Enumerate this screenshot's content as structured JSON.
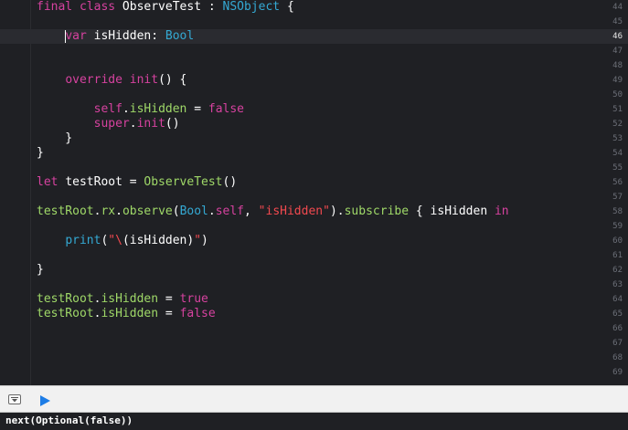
{
  "editor": {
    "lines": [
      {
        "num": "44",
        "tokens": [
          {
            "t": "kw",
            "v": "final class "
          },
          {
            "t": "pl",
            "v": "ObserveTest : "
          },
          {
            "t": "ty",
            "v": "NSObject"
          },
          {
            "t": "pl",
            "v": " {"
          }
        ]
      },
      {
        "num": "45",
        "tokens": []
      },
      {
        "num": "46",
        "current": true,
        "tokens": [
          {
            "t": "pl",
            "v": "    "
          },
          {
            "t": "cursor",
            "v": ""
          },
          {
            "t": "kw",
            "v": "var "
          },
          {
            "t": "pl",
            "v": "isHidden: "
          },
          {
            "t": "ty",
            "v": "Bool"
          }
        ]
      },
      {
        "num": "47",
        "tokens": []
      },
      {
        "num": "48",
        "tokens": []
      },
      {
        "num": "49",
        "tokens": [
          {
            "t": "pl",
            "v": "    "
          },
          {
            "t": "kw",
            "v": "override init"
          },
          {
            "t": "pl",
            "v": "() {"
          }
        ]
      },
      {
        "num": "50",
        "tokens": []
      },
      {
        "num": "51",
        "tokens": [
          {
            "t": "pl",
            "v": "        "
          },
          {
            "t": "kw",
            "v": "self"
          },
          {
            "t": "pl",
            "v": "."
          },
          {
            "t": "fn",
            "v": "isHidden"
          },
          {
            "t": "pl",
            "v": " = "
          },
          {
            "t": "kw",
            "v": "false"
          }
        ]
      },
      {
        "num": "52",
        "tokens": [
          {
            "t": "pl",
            "v": "        "
          },
          {
            "t": "kw",
            "v": "super"
          },
          {
            "t": "pl",
            "v": "."
          },
          {
            "t": "kw",
            "v": "init"
          },
          {
            "t": "pl",
            "v": "()"
          }
        ]
      },
      {
        "num": "53",
        "tokens": [
          {
            "t": "pl",
            "v": "    }"
          }
        ]
      },
      {
        "num": "54",
        "tokens": [
          {
            "t": "pl",
            "v": "}"
          }
        ]
      },
      {
        "num": "55",
        "tokens": []
      },
      {
        "num": "56",
        "tokens": [
          {
            "t": "kw",
            "v": "let "
          },
          {
            "t": "pl",
            "v": "testRoot = "
          },
          {
            "t": "fn",
            "v": "ObserveTest"
          },
          {
            "t": "pl",
            "v": "()"
          }
        ]
      },
      {
        "num": "57",
        "tokens": []
      },
      {
        "num": "58",
        "tokens": [
          {
            "t": "fn",
            "v": "testRoot"
          },
          {
            "t": "pl",
            "v": "."
          },
          {
            "t": "fn",
            "v": "rx"
          },
          {
            "t": "pl",
            "v": "."
          },
          {
            "t": "fn",
            "v": "observe"
          },
          {
            "t": "pl",
            "v": "("
          },
          {
            "t": "ty",
            "v": "Bool"
          },
          {
            "t": "pl",
            "v": "."
          },
          {
            "t": "kw",
            "v": "self"
          },
          {
            "t": "pl",
            "v": ", "
          },
          {
            "t": "str",
            "v": "\"isHidden\""
          },
          {
            "t": "pl",
            "v": ")."
          },
          {
            "t": "fn",
            "v": "subscribe"
          },
          {
            "t": "pl",
            "v": " { isHidden "
          },
          {
            "t": "kw",
            "v": "in"
          }
        ]
      },
      {
        "num": "59",
        "tokens": []
      },
      {
        "num": "60",
        "tokens": [
          {
            "t": "pl",
            "v": "    "
          },
          {
            "t": "ty",
            "v": "print"
          },
          {
            "t": "pl",
            "v": "("
          },
          {
            "t": "str",
            "v": "\"\\"
          },
          {
            "t": "pl",
            "v": "(isHidden)"
          },
          {
            "t": "str",
            "v": "\""
          },
          {
            "t": "pl",
            "v": ")"
          }
        ]
      },
      {
        "num": "61",
        "tokens": []
      },
      {
        "num": "62",
        "tokens": [
          {
            "t": "pl",
            "v": "}"
          }
        ]
      },
      {
        "num": "63",
        "tokens": []
      },
      {
        "num": "64",
        "tokens": [
          {
            "t": "fn",
            "v": "testRoot"
          },
          {
            "t": "pl",
            "v": "."
          },
          {
            "t": "fn",
            "v": "isHidden"
          },
          {
            "t": "pl",
            "v": " = "
          },
          {
            "t": "kw",
            "v": "true"
          }
        ]
      },
      {
        "num": "65",
        "tokens": [
          {
            "t": "fn",
            "v": "testRoot"
          },
          {
            "t": "pl",
            "v": "."
          },
          {
            "t": "fn",
            "v": "isHidden"
          },
          {
            "t": "pl",
            "v": " = "
          },
          {
            "t": "kw",
            "v": "false"
          }
        ]
      },
      {
        "num": "66",
        "tokens": []
      },
      {
        "num": "67",
        "tokens": []
      },
      {
        "num": "68",
        "tokens": []
      },
      {
        "num": "69",
        "tokens": []
      }
    ]
  },
  "toolbar": {
    "hide_debug_icon": "hide-debug-area-icon",
    "run_icon": "play-icon"
  },
  "console": {
    "output": "next(Optional(false))"
  },
  "colors": {
    "keyword": "#d6429f",
    "type": "#34a9d3",
    "function": "#9fd868",
    "string": "#f2494f",
    "background": "#1f2024",
    "run_button": "#1e7de6"
  }
}
